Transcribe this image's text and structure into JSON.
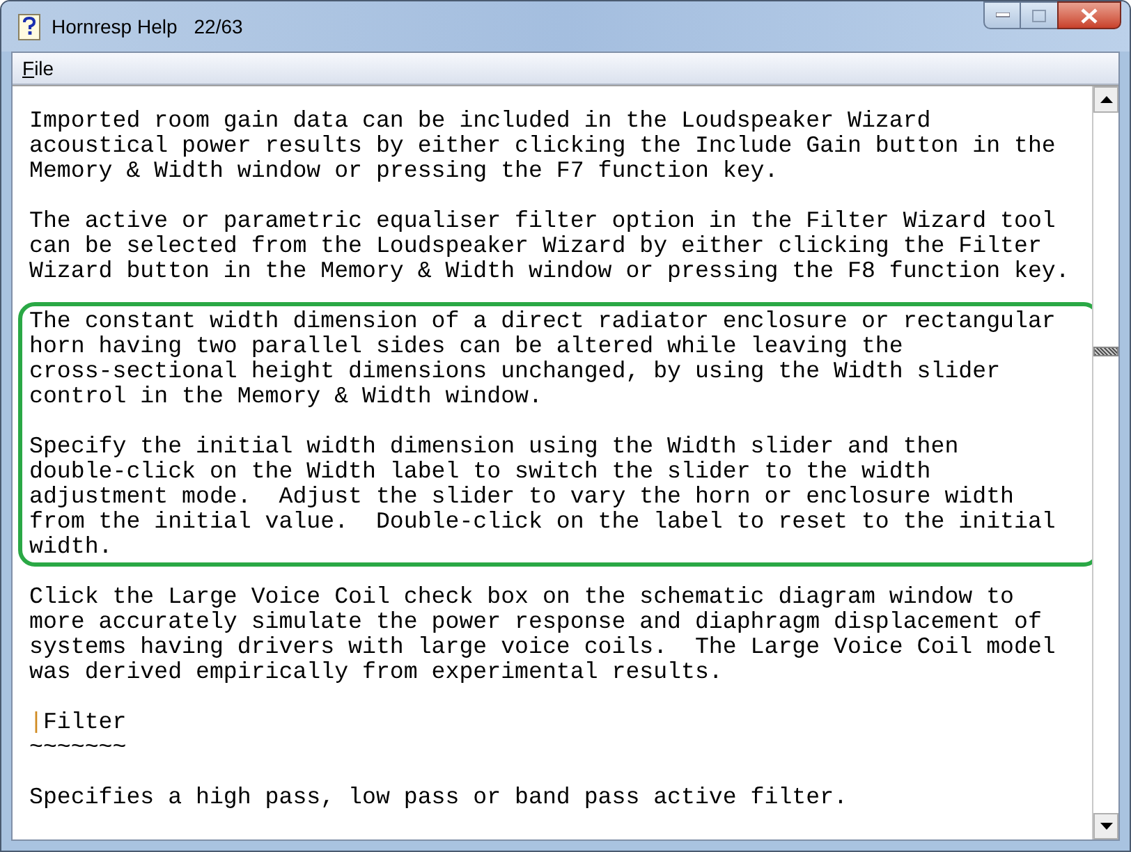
{
  "window": {
    "title": "Hornresp Help",
    "page": "22/63"
  },
  "menu": [
    {
      "label": "File"
    }
  ],
  "blocks": [
    {
      "highlighted": false,
      "items": [
        {
          "kind": "paragraph",
          "text": "Imported room gain data can be included in the Loudspeaker Wizard\nacoustical power results by either clicking the Include Gain button in the\nMemory & Width window or pressing the F7 function key."
        },
        {
          "kind": "paragraph",
          "text": "The active or parametric equaliser filter option in the Filter Wizard tool\ncan be selected from the Loudspeaker Wizard by either clicking the Filter\nWizard button in the Memory & Width window or pressing the F8 function key."
        }
      ]
    },
    {
      "highlighted": true,
      "items": [
        {
          "kind": "paragraph",
          "text": "The constant width dimension of a direct radiator enclosure or rectangular\nhorn having two parallel sides can be altered while leaving the\ncross-sectional height dimensions unchanged, by using the Width slider\ncontrol in the Memory & Width window."
        },
        {
          "kind": "paragraph",
          "text": "Specify the initial width dimension using the Width slider and then\ndouble-click on the Width label to switch the slider to the width\nadjustment mode.  Adjust the slider to vary the horn or enclosure width\nfrom the initial value.  Double-click on the label to reset to the initial\nwidth."
        }
      ]
    },
    {
      "highlighted": false,
      "items": [
        {
          "kind": "paragraph",
          "text": "Click the Large Voice Coil check box on the schematic diagram window to\nmore accurately simulate the power response and diaphragm displacement of\nsystems having drivers with large voice coils.  The Large Voice Coil model\nwas derived empirically from experimental results."
        },
        {
          "kind": "heading",
          "marker": "|",
          "text": "Filter",
          "underline": "~~~~~~~"
        },
        {
          "kind": "paragraph",
          "text": "Specifies a high pass, low pass or band pass active filter."
        }
      ]
    }
  ]
}
